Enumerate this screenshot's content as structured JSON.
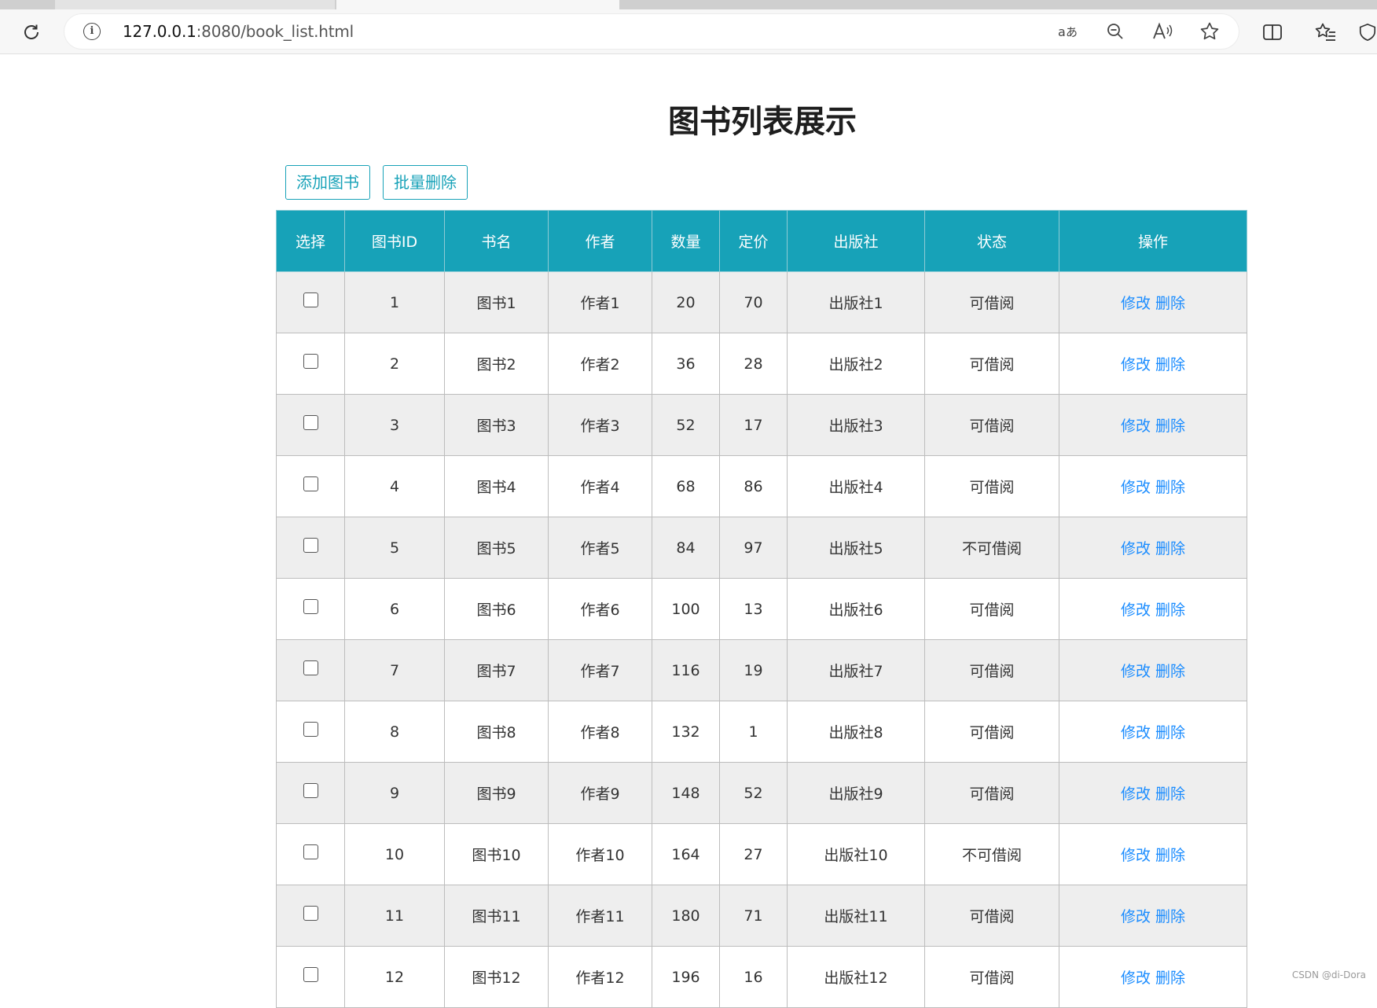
{
  "browser": {
    "url_host": "127.0.0.1",
    "url_rest": ":8080/book_list.html"
  },
  "page": {
    "title": "图书列表展示",
    "add_button": "添加图书",
    "batch_delete_button": "批量删除"
  },
  "table": {
    "headers": [
      "选择",
      "图书ID",
      "书名",
      "作者",
      "数量",
      "定价",
      "出版社",
      "状态",
      "操作"
    ],
    "rows": [
      {
        "id": "1",
        "name": "图书1",
        "author": "作者1",
        "count": "20",
        "price": "70",
        "publisher": "出版社1",
        "status": "可借阅",
        "edit": "修改",
        "delete": "删除"
      },
      {
        "id": "2",
        "name": "图书2",
        "author": "作者2",
        "count": "36",
        "price": "28",
        "publisher": "出版社2",
        "status": "可借阅",
        "edit": "修改",
        "delete": "删除"
      },
      {
        "id": "3",
        "name": "图书3",
        "author": "作者3",
        "count": "52",
        "price": "17",
        "publisher": "出版社3",
        "status": "可借阅",
        "edit": "修改",
        "delete": "删除"
      },
      {
        "id": "4",
        "name": "图书4",
        "author": "作者4",
        "count": "68",
        "price": "86",
        "publisher": "出版社4",
        "status": "可借阅",
        "edit": "修改",
        "delete": "删除"
      },
      {
        "id": "5",
        "name": "图书5",
        "author": "作者5",
        "count": "84",
        "price": "97",
        "publisher": "出版社5",
        "status": "不可借阅",
        "edit": "修改",
        "delete": "删除"
      },
      {
        "id": "6",
        "name": "图书6",
        "author": "作者6",
        "count": "100",
        "price": "13",
        "publisher": "出版社6",
        "status": "可借阅",
        "edit": "修改",
        "delete": "删除"
      },
      {
        "id": "7",
        "name": "图书7",
        "author": "作者7",
        "count": "116",
        "price": "19",
        "publisher": "出版社7",
        "status": "可借阅",
        "edit": "修改",
        "delete": "删除"
      },
      {
        "id": "8",
        "name": "图书8",
        "author": "作者8",
        "count": "132",
        "price": "1",
        "publisher": "出版社8",
        "status": "可借阅",
        "edit": "修改",
        "delete": "删除"
      },
      {
        "id": "9",
        "name": "图书9",
        "author": "作者9",
        "count": "148",
        "price": "52",
        "publisher": "出版社9",
        "status": "可借阅",
        "edit": "修改",
        "delete": "删除"
      },
      {
        "id": "10",
        "name": "图书10",
        "author": "作者10",
        "count": "164",
        "price": "27",
        "publisher": "出版社10",
        "status": "不可借阅",
        "edit": "修改",
        "delete": "删除"
      },
      {
        "id": "11",
        "name": "图书11",
        "author": "作者11",
        "count": "180",
        "price": "71",
        "publisher": "出版社11",
        "status": "可借阅",
        "edit": "修改",
        "delete": "删除"
      },
      {
        "id": "12",
        "name": "图书12",
        "author": "作者12",
        "count": "196",
        "price": "16",
        "publisher": "出版社12",
        "status": "可借阅",
        "edit": "修改",
        "delete": "删除"
      }
    ]
  },
  "watermark": "CSDN @di-Dora",
  "colors": {
    "accent": "#17a2b8",
    "link": "#1a8cff",
    "row_stripe": "#eeeeee"
  },
  "icons": [
    "refresh-icon",
    "info-icon",
    "translate-icon",
    "zoom-out-icon",
    "read-aloud-icon",
    "favorite-star-icon",
    "split-screen-icon",
    "favorites-list-icon",
    "shield-icon"
  ]
}
